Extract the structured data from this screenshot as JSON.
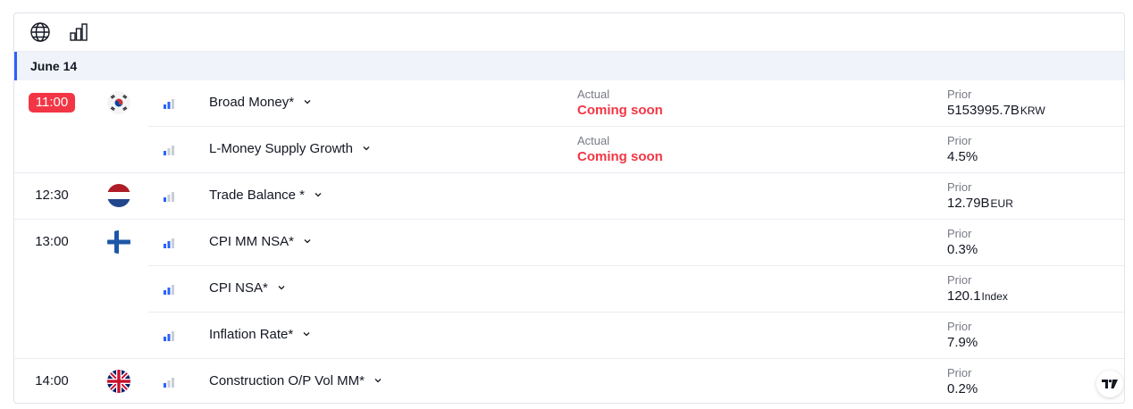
{
  "toolbar": {
    "items": [
      {
        "icon": "globe-icon"
      },
      {
        "icon": "importance-bars-icon"
      }
    ]
  },
  "date_header": "June 14",
  "colors": {
    "accent": "#2962ff",
    "live_time_bg": "#f23645",
    "coming_soon": "#f23645",
    "importance_active": "#2962ff",
    "importance_inactive": "#c9cdd6"
  },
  "labels": {
    "actual": "Actual",
    "prior": "Prior"
  },
  "events": [
    {
      "time": "11:00",
      "time_live": true,
      "country": "south-korea-flag-icon",
      "importance": 2,
      "name": "Broad Money*",
      "actual": "Coming soon",
      "prior": "5153995.7B",
      "prior_unit": "KRW"
    },
    {
      "time": "",
      "country": "",
      "importance": 1,
      "name": "L-Money Supply Growth",
      "actual": "Coming soon",
      "prior": "4.5%",
      "prior_unit": ""
    },
    {
      "time": "12:30",
      "country": "netherlands-flag-icon",
      "importance": 1,
      "name": "Trade Balance *",
      "actual": "",
      "prior": "12.79B",
      "prior_unit": "EUR"
    },
    {
      "time": "13:00",
      "country": "finland-flag-icon",
      "importance": 2,
      "name": "CPI MM NSA*",
      "actual": "",
      "prior": "0.3%",
      "prior_unit": ""
    },
    {
      "time": "",
      "country": "",
      "importance": 2,
      "name": "CPI NSA*",
      "actual": "",
      "prior": "120.1",
      "prior_unit": "Index"
    },
    {
      "time": "",
      "country": "",
      "importance": 2,
      "name": "Inflation Rate*",
      "actual": "",
      "prior": "7.9%",
      "prior_unit": ""
    },
    {
      "time": "14:00",
      "country": "uk-flag-icon",
      "importance": 1,
      "name": "Construction O/P Vol MM*",
      "actual": "",
      "prior": "0.2%",
      "prior_unit": ""
    }
  ],
  "watermark": "tradingview-logo-icon"
}
